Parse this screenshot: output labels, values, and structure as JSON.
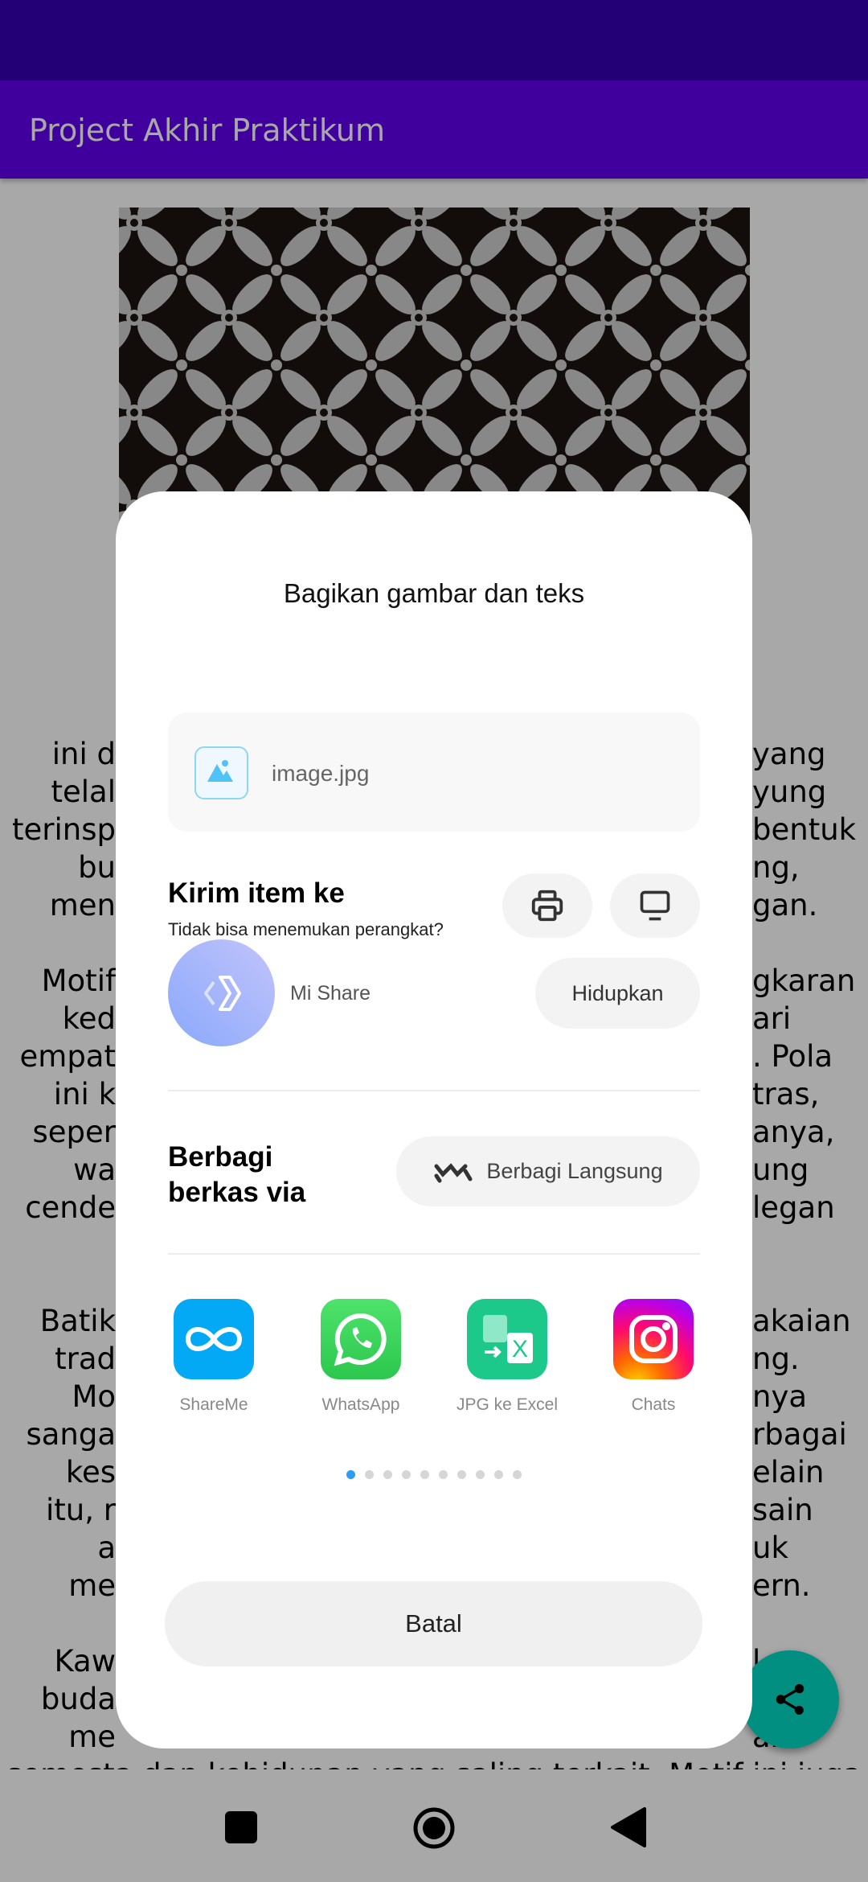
{
  "app_bar": {
    "title": "Project Akhir Praktikum"
  },
  "colors": {
    "primary": "#6200EE",
    "primary_dark": "#3700B3",
    "fab": "#03DAC5",
    "dot_active": "#2d9cf2"
  },
  "background_text": {
    "lines": [
      {
        "l": "ini d",
        "r": "yang"
      },
      {
        "l": "telal",
        "r": "yung"
      },
      {
        "l": "terinsp",
        "r": "bentuk"
      },
      {
        "l": "bu",
        "r": "ng,"
      },
      {
        "l": "men",
        "r": "gan."
      },
      {
        "l": "",
        "r": ""
      },
      {
        "l": "Motif",
        "r": "gkaran"
      },
      {
        "l": "ked",
        "r": "ari"
      },
      {
        "l": "empat",
        "r": ". Pola"
      },
      {
        "l": "ini k",
        "r": "tras,"
      },
      {
        "l": "seper",
        "r": "anya,"
      },
      {
        "l": "wa",
        "r": "ung"
      },
      {
        "l": "cende",
        "r": "legan"
      },
      {
        "l": "",
        "r": ""
      },
      {
        "l": "",
        "r": ""
      },
      {
        "l": "Batik",
        "r": "akaian"
      },
      {
        "l": "trad",
        "r": "ng."
      },
      {
        "l": "Mo",
        "r": "nya"
      },
      {
        "l": "sanga",
        "r": "rbagai"
      },
      {
        "l": "kes",
        "r": "elain"
      },
      {
        "l": "itu, r",
        "r": "sain"
      },
      {
        "l": "a",
        "r": "uk"
      },
      {
        "l": "me",
        "r": "ern."
      },
      {
        "l": "",
        "r": ""
      },
      {
        "l": "Kaw",
        "r": "l"
      },
      {
        "l": "buda",
        "r": ""
      },
      {
        "l": "me",
        "r": "an"
      }
    ],
    "last_line": "semesta dan kehidupan yang saling terkait. Motif ini juga"
  },
  "dialog": {
    "title": "Bagikan gambar dan teks",
    "file": {
      "name": "image.jpg",
      "icon": "image-icon"
    },
    "send_section": {
      "title": "Kirim item ke",
      "subtitle": "Tidak bisa menemukan perangkat?",
      "print_icon": "printer-icon",
      "screen_icon": "monitor-icon"
    },
    "mi_share": {
      "label": "Mi Share",
      "button": "Hidupkan"
    },
    "share_via": {
      "title": "Berbagi berkas via",
      "button": "Berbagi Langsung"
    },
    "apps": [
      {
        "label": "ShareMe",
        "icon": "shareme-icon"
      },
      {
        "label": "WhatsApp",
        "icon": "whatsapp-icon"
      },
      {
        "label": "JPG ke Excel",
        "icon": "jpg-to-excel-icon"
      },
      {
        "label": "Chats",
        "icon": "instagram-icon"
      }
    ],
    "page_count": 10,
    "active_page": 1,
    "cancel": "Batal"
  },
  "fab": {
    "icon": "share-icon"
  },
  "navbar": {
    "icons": [
      "recents-icon",
      "home-icon",
      "back-icon"
    ]
  }
}
